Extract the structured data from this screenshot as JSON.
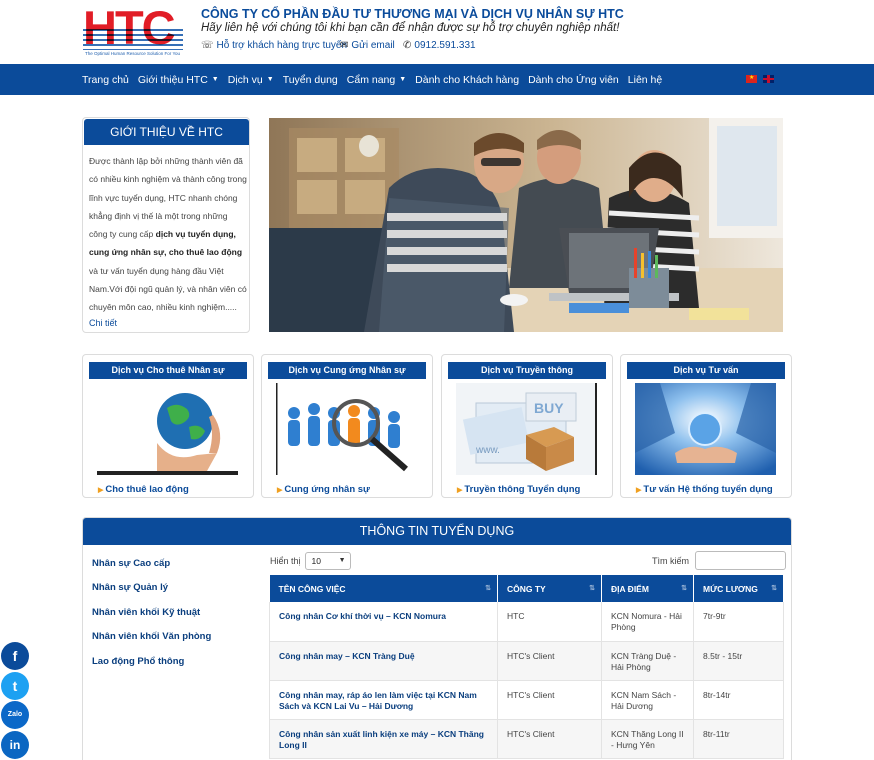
{
  "header": {
    "logo_text": "HTC",
    "logo_tagline": "The Optimal Human Resource Solution For You",
    "company_name": "CÔNG TY CỔ PHẦN ĐẦU TƯ THƯƠNG MẠI VÀ DỊCH VỤ NHÂN SỰ HTC",
    "slogan": "Hãy liên hệ với chúng tôi khi bạn cần để nhận được sự hỗ trợ chuyên nghiệp nhất!",
    "support_label": "Hỗ trợ khách hàng trực tuyến",
    "email_label": "Gửi email",
    "phone": "0912.591.331"
  },
  "nav": {
    "items": [
      {
        "label": "Trang chủ"
      },
      {
        "label": "Giới thiệu HTC"
      },
      {
        "label": "Dịch vụ"
      },
      {
        "label": "Tuyển dụng"
      },
      {
        "label": "Cẩm nang"
      },
      {
        "label": "Dành cho Khách hàng"
      },
      {
        "label": "Dành cho Ứng viên"
      },
      {
        "label": "Liên hệ"
      }
    ]
  },
  "intro": {
    "title": "GIỚI THIỆU VỀ HTC",
    "text_1": "Được thành lập bởi những thành viên đã có nhiều kinh nghiệm và thành công trong lĩnh vực tuyển dụng, HTC nhanh chóng khẳng định vị thế là một trong những công ty cung cấp ",
    "text_bold": "dịch vụ tuyển dụng, cung ứng nhân sự, cho thuê lao động",
    "text_2": " và tư vấn tuyển dụng hàng đầu Việt Nam.Với đội ngũ quản lý, và nhân viên có chuyên môn cao, nhiều kinh nghiệm.....",
    "more": "Chi tiết"
  },
  "services": [
    {
      "title": "Dịch vụ Cho thuê Nhân sự",
      "link": "Cho thuê lao động"
    },
    {
      "title": "Dịch vụ Cung ứng Nhân sự",
      "link": "Cung ứng nhân sự"
    },
    {
      "title": "Dịch vụ Truyền thông",
      "link": "Truyền thông Tuyển dụng"
    },
    {
      "title": "Dịch vụ Tư vấn",
      "link": "Tư vấn Hệ thống tuyển dụng"
    }
  ],
  "recruit": {
    "title": "THÔNG TIN TUYỂN DỤNG",
    "categories": [
      "Nhân sự Cao cấp",
      "Nhân sự Quản lý",
      "Nhân viên khối Kỹ thuật",
      "Nhân viên khối Văn phòng",
      "Lao động Phổ thông"
    ],
    "show_label": "Hiển thị",
    "page_size": "10",
    "search_label": "Tìm kiếm",
    "search_value": "",
    "columns": [
      "TÊN CÔNG VIỆC",
      "CÔNG TY",
      "ĐỊA ĐIỂM",
      "MỨC LƯƠNG"
    ],
    "rows": [
      {
        "job": "Công nhân Cơ khí thời vụ – KCN Nomura",
        "company": "HTC",
        "location": "KCN Nomura - Hải Phòng",
        "salary": "7tr-9tr"
      },
      {
        "job": "Công nhân may – KCN Tràng Duệ",
        "company": "HTC's Client",
        "location": "KCN Tràng Duệ - Hải Phòng",
        "salary": "8.5tr - 15tr"
      },
      {
        "job": "Công nhân may, ráp áo len làm việc tại KCN Nam Sách và KCN Lai Vu – Hải Dương",
        "company": "HTC's Client",
        "location": "KCN Nam Sách - Hải Dương",
        "salary": "8tr-14tr"
      },
      {
        "job": "Công nhân sản xuất linh kiện xe máy – KCN Thăng Long II",
        "company": "HTC's Client",
        "location": "KCN Thăng Long II - Hưng Yên",
        "salary": "8tr-11tr"
      }
    ]
  },
  "social": {
    "zalo": "Zalo",
    "linkedin": "in",
    "facebook": "f",
    "twitter": "t"
  },
  "colors": {
    "brand_blue": "#0b4b9a",
    "logo_red": "#e11d26",
    "accent_orange": "#f0a020"
  }
}
